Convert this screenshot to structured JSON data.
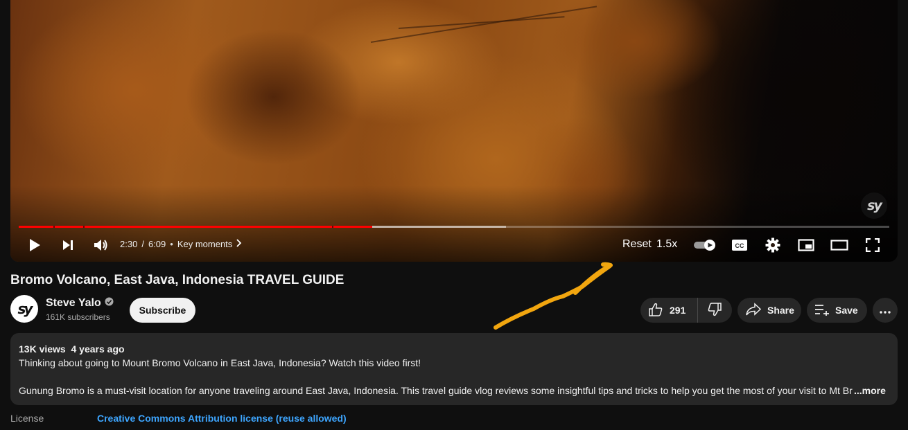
{
  "player": {
    "time_current": "2:30",
    "time_separator": "/",
    "time_total": "6:09",
    "chapters_label": "Key moments",
    "reset_label": "Reset",
    "speed_label": "1.5x",
    "played_fraction": 0.406,
    "loaded_fraction": 0.56,
    "chapter_markers": [
      0.04,
      0.074,
      0.36
    ],
    "progress_colors": {
      "played": "#ff0000",
      "loaded": "#cccccc"
    },
    "controls": [
      "play-icon",
      "next-icon",
      "volume-icon",
      "autoplay-toggle",
      "captions-icon",
      "settings-icon",
      "miniplayer-icon",
      "theater-icon",
      "fullscreen-icon"
    ]
  },
  "video": {
    "title": "Bromo Volcano, East Java, Indonesia TRAVEL GUIDE"
  },
  "channel": {
    "name": "Steve Yalo",
    "subscribers": "161K subscribers",
    "avatar_text": "sy",
    "subscribe_label": "Subscribe"
  },
  "actions": {
    "like_count": "291",
    "share_label": "Share",
    "save_label": "Save"
  },
  "description": {
    "views": "13K views",
    "age": "4 years ago",
    "line1": "Thinking about going to Mount Bromo Volcano in East Java, Indonesia? Watch this video first!",
    "line2": "Gunung Bromo is a must-visit location for anyone traveling around East Java, Indonesia. This travel guide vlog reviews some insightful tips and tricks to help you get the most of your visit to Mt Br",
    "more_label": "...more"
  },
  "license": {
    "label": "License",
    "value": "Creative Commons Attribution license (reuse allowed)"
  },
  "annotation": {
    "arrow_color": "#f2a60f"
  }
}
